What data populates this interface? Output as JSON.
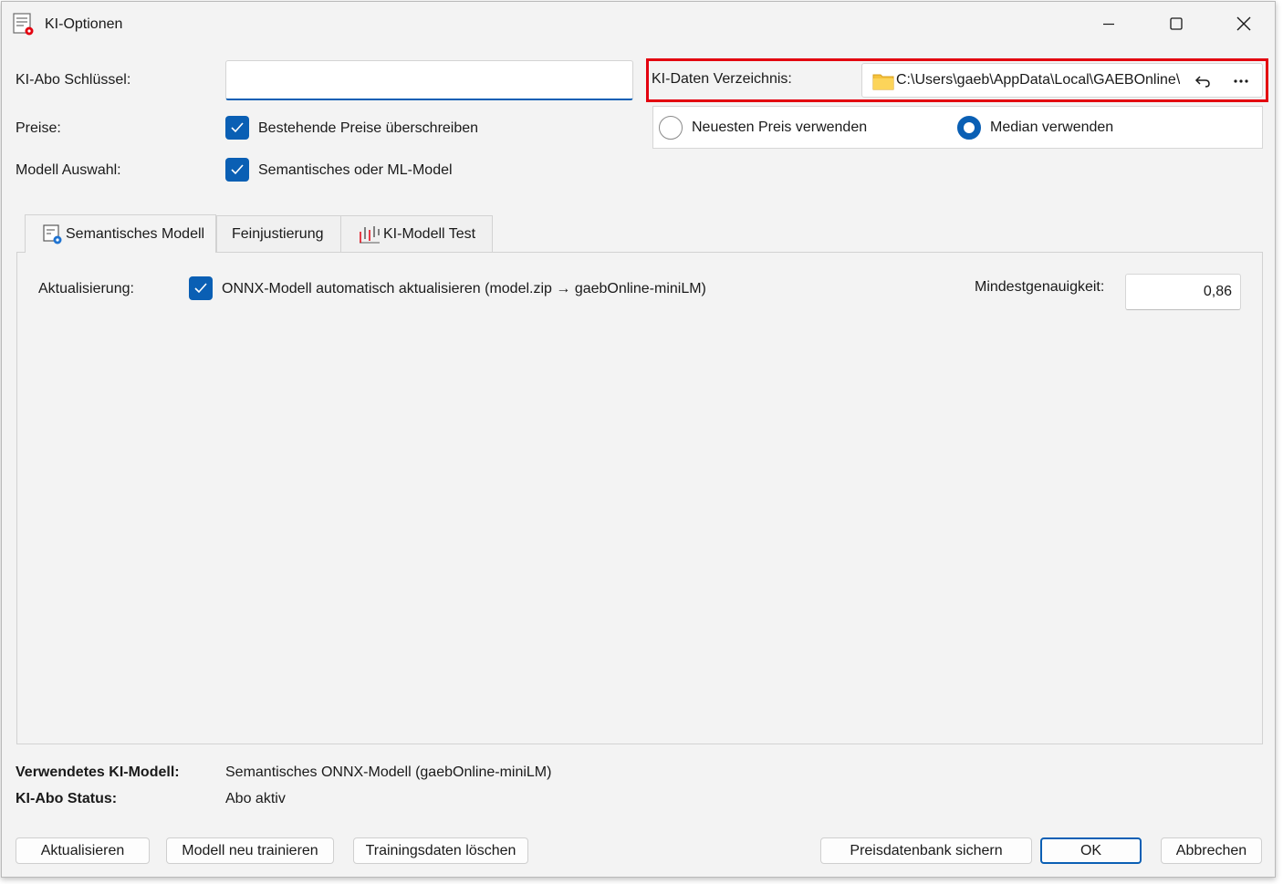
{
  "window": {
    "title": "KI-Optionen",
    "icons": {
      "app": "settings-document-icon",
      "minimize": "minimize-icon",
      "maximize": "maximize-icon",
      "close": "close-icon"
    }
  },
  "form": {
    "abo_key_label": "KI-Abo Schlüssel:",
    "abo_key_value": "",
    "data_dir_label": "KI-Daten Verzeichnis:",
    "data_dir_value": "C:\\Users\\gaeb\\AppData\\Local\\GAEBOnline\\I",
    "prices_label": "Preise:",
    "overwrite_prices_label": "Bestehende Preise überschreiben",
    "overwrite_prices_checked": true,
    "price_option_latest": "Neuesten Preis verwenden",
    "price_option_median": "Median verwenden",
    "price_option_selected": "median",
    "model_select_label": "Modell Auswahl:",
    "semantic_model_label": "Semantisches oder ML-Model",
    "semantic_model_checked": true
  },
  "tabs": [
    {
      "label": "Semantisches Modell",
      "icon": "semantic-model-icon",
      "active": true
    },
    {
      "label": "Feinjustierung",
      "active": false
    },
    {
      "label": "KI-Modell Test",
      "icon": "chart-test-icon",
      "active": false
    }
  ],
  "panel": {
    "update_label": "Aktualisierung:",
    "auto_update_label": "ONNX-Modell automatisch aktualisieren (model.zip → gaebOnline-miniLM)",
    "auto_update_checked": true,
    "min_accuracy_label": "Mindestgenauigkeit:",
    "min_accuracy_value": "0,86"
  },
  "status": {
    "model_label": "Verwendetes KI-Modell:",
    "model_value": "Semantisches ONNX-Modell (gaebOnline-miniLM)",
    "abo_status_label": "KI-Abo Status:",
    "abo_status_value": "Abo aktiv"
  },
  "buttons": {
    "refresh": "Aktualisieren",
    "retrain": "Modell neu trainieren",
    "delete_training": "Trainingsdaten löschen",
    "backup_db": "Preisdatenbank sichern",
    "ok": "OK",
    "cancel": "Abbrechen"
  },
  "colors": {
    "accent": "#0a5fb4",
    "highlight": "#e3000f",
    "folder": "#f5c23c"
  }
}
